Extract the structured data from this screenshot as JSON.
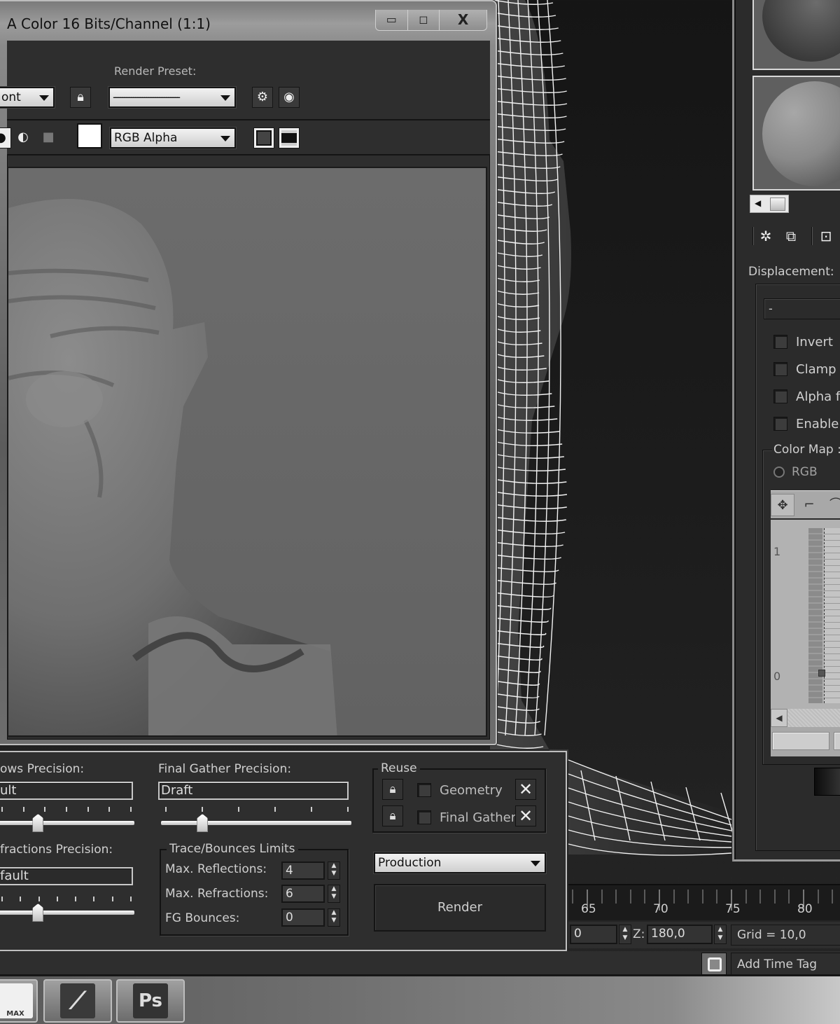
{
  "render_window": {
    "title": "A Color 16 Bits/Channel (1:1)",
    "caption_buttons": {
      "minimize": "▭",
      "maximize": "◻",
      "close": "X"
    },
    "area_dropdown": "ont",
    "render_preset_label": "Render Preset:",
    "render_preset_value": "------------------------------",
    "channel_dropdown": "RGB Alpha"
  },
  "render_setup": {
    "shadows_precision_label": "ows Precision:",
    "shadows_precision_value": "ult",
    "shadows_slider_fraction": 0.28,
    "refractions_precision_label": "fractions Precision:",
    "refractions_precision_value": "fault",
    "refractions_slider_fraction": 0.28,
    "fg_precision_label": "Final Gather Precision:",
    "fg_precision_value": "Draft",
    "fg_slider_fraction": 0.2,
    "trace_group_title": "Trace/Bounces Limits",
    "max_reflections_label": "Max. Reflections:",
    "max_reflections_value": "4",
    "max_refractions_label": "Max. Refractions:",
    "max_refractions_value": "6",
    "fg_bounces_label": "FG Bounces:",
    "fg_bounces_value": "0",
    "reuse_group_title": "Reuse",
    "reuse_geometry_label": "Geometry",
    "reuse_final_gather_label": "Final Gather",
    "mode_dropdown": "Production",
    "render_button": "Render"
  },
  "material_panel": {
    "displacement_label": "Displacement:",
    "rollout_title": "-",
    "checkboxes": [
      "Invert",
      "Clamp",
      "Alpha fro",
      "Enable C"
    ],
    "color_map_label": "Color Map :",
    "rgb_radio_label": "RGB",
    "curve_labels": {
      "top": "1",
      "bottom": "0"
    }
  },
  "timeline": {
    "ticks": [
      "65",
      "70",
      "75",
      "80"
    ]
  },
  "coordinates": {
    "y_value": "0",
    "z_label": "Z:",
    "z_value": "180,0",
    "grid": "Grid = 10,0"
  },
  "status": {
    "add_time_tag": "Add Time Tag"
  },
  "taskbar": {
    "apps": [
      {
        "name": "3ds Max",
        "label": "MAX"
      },
      {
        "name": "Dota 2",
        "label": ""
      },
      {
        "name": "Photoshop",
        "label": "Ps"
      }
    ]
  }
}
